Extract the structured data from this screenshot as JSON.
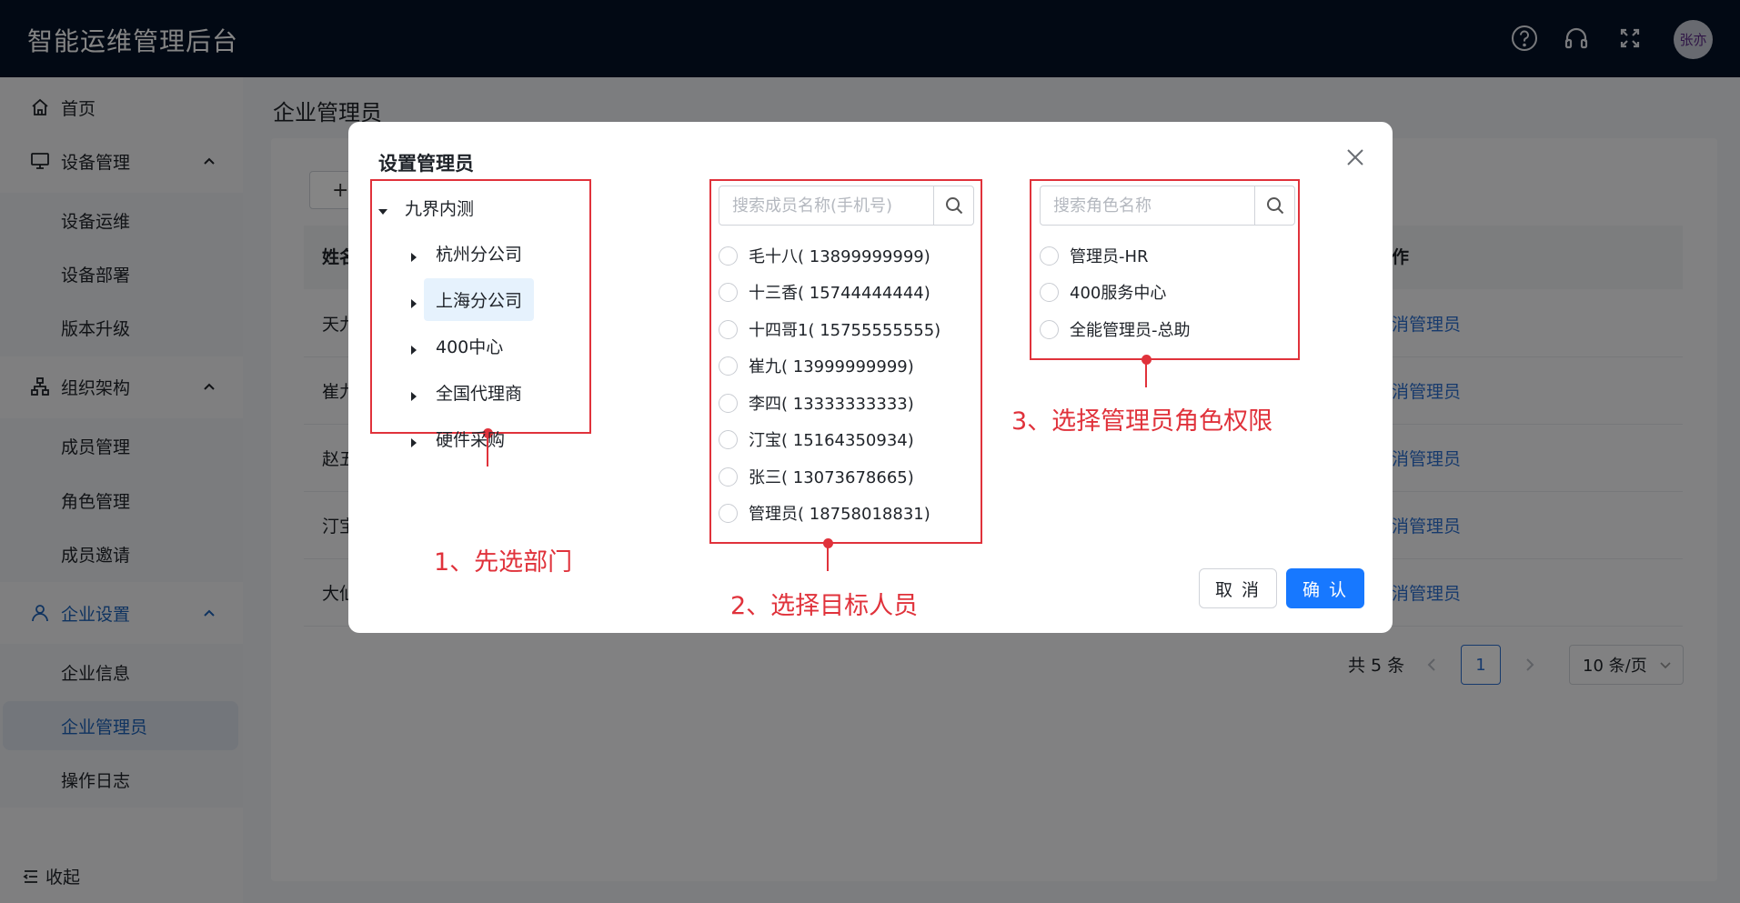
{
  "header": {
    "title": "智能运维管理后台",
    "user_avatar": "张亦"
  },
  "sidebar": {
    "home": "首页",
    "device_mgmt": {
      "label": "设备管理",
      "items": [
        "设备运维",
        "设备部署",
        "版本升级"
      ]
    },
    "org": {
      "label": "组织架构",
      "items": [
        "成员管理",
        "角色管理",
        "成员邀请"
      ]
    },
    "enterprise": {
      "label": "企业设置",
      "items": [
        "企业信息",
        "企业管理员",
        "操作日志"
      ]
    },
    "collapse": "收起"
  },
  "page": {
    "title": "企业管理员",
    "add_symbol": "+",
    "table": {
      "col_name_partial": "姓名",
      "col_op_partial": "作",
      "rows": [
        {
          "name_partial": "天九",
          "op_partial": "消管理员"
        },
        {
          "name_partial": "崔九",
          "op_partial": "消管理员"
        },
        {
          "name_partial": "赵五",
          "op_partial": "消管理员"
        },
        {
          "name_partial": "汀宝",
          "op_partial": "消管理员"
        },
        {
          "name_partial": "大仙",
          "op_partial": "消管理员"
        }
      ]
    },
    "pager": {
      "total": "共 5 条",
      "current": "1",
      "page_size": "10 条/页"
    }
  },
  "modal": {
    "title": "设置管理员",
    "tree": {
      "root": "九界内测",
      "children": [
        "杭州分公司",
        "上海分公司",
        "400中心",
        "全国代理商",
        "硬件采购"
      ],
      "selected": "上海分公司"
    },
    "member_search_placeholder": "搜索成员名称(手机号)",
    "members": [
      "毛十八( 13899999999)",
      "十三香( 15744444444)",
      "十四哥1( 15755555555)",
      "崔九( 13999999999)",
      "李四( 13333333333)",
      "汀宝( 15164350934)",
      "张三( 13073678665)",
      "管理员( 18758018831)"
    ],
    "role_search_placeholder": "搜索角色名称",
    "roles": [
      "管理员-HR",
      "400服务中心",
      "全能管理员-总助"
    ],
    "cancel": "取 消",
    "confirm": "确 认"
  },
  "annotations": {
    "step1": "1、先选部门",
    "step2": "2、选择目标人员",
    "step3": "3、选择管理员角色权限",
    "color": "#e0323b"
  },
  "colors": {
    "header_bg": "#051327",
    "accent": "#1778ff",
    "link": "#2d6fd0"
  }
}
